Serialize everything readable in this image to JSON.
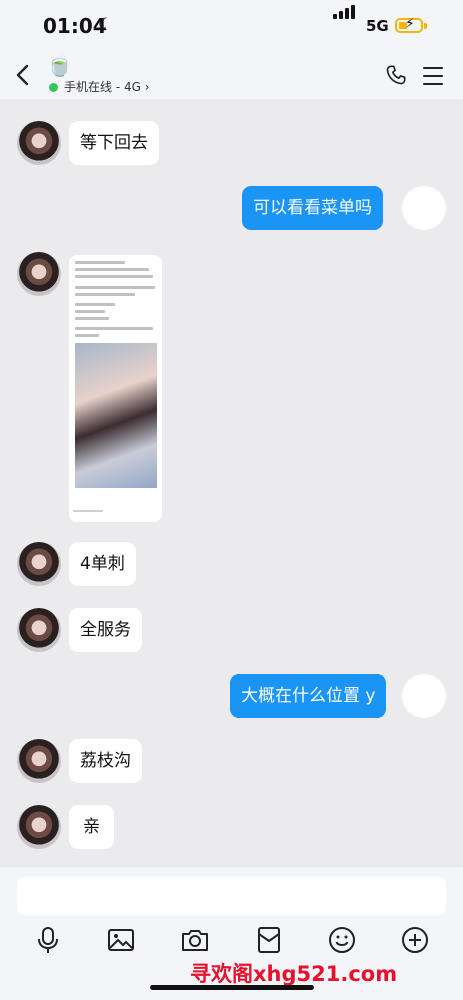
{
  "status": {
    "time": "01:04",
    "network": "5G"
  },
  "header": {
    "contact_emoji": "🍵",
    "online_status": "手机在线 - 4G"
  },
  "messages": [
    {
      "side": "in",
      "type": "text",
      "text": "等下回去"
    },
    {
      "side": "out",
      "type": "text",
      "text": "可以看看菜单吗"
    },
    {
      "side": "in",
      "type": "image"
    },
    {
      "side": "in",
      "type": "text",
      "text": "4单刺"
    },
    {
      "side": "in",
      "type": "text",
      "text": "全服务"
    },
    {
      "side": "out",
      "type": "text",
      "text": "大概在什么位置 y"
    },
    {
      "side": "in",
      "type": "text",
      "text": "荔枝沟"
    },
    {
      "side": "in",
      "type": "text",
      "text": "亲"
    }
  ],
  "input": {
    "placeholder": ""
  },
  "toolbar": [
    "microphone-icon",
    "image-icon",
    "camera-icon",
    "red-packet-icon",
    "emoji-icon",
    "plus-icon"
  ],
  "watermark": "寻欢阁xhg521.com",
  "colors": {
    "outgoing_bubble": "#1a94f5",
    "online_dot": "#34c759",
    "watermark": "#e8112d"
  }
}
